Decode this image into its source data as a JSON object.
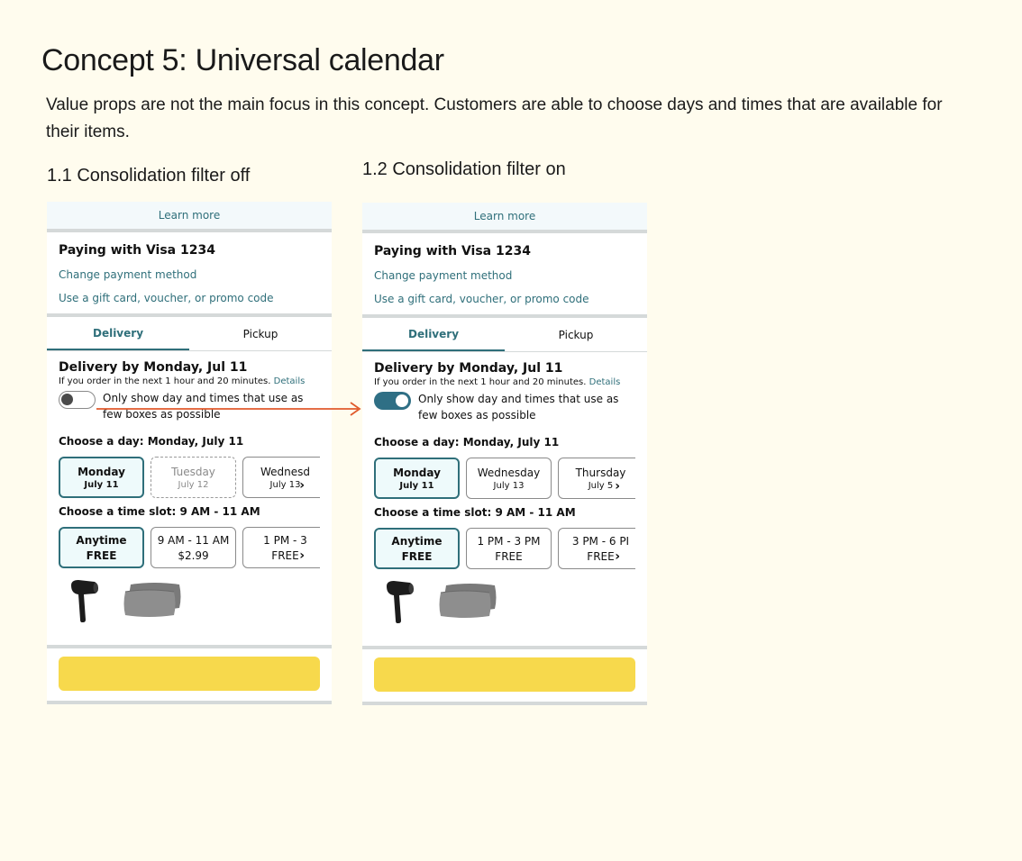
{
  "page": {
    "title": "Concept 5: Universal calendar",
    "description": "Value props are not the main focus in this concept. Customers are able to choose days and times that are available for their items.",
    "label_left": "1.1 Consolidation filter off",
    "label_right": "1.2 Consolidation filter on"
  },
  "colors": {
    "background": "#fffcee",
    "accent": "#2f6f7a",
    "cta": "#f7d94c",
    "arrow": "#e05a2b"
  },
  "left": {
    "learn_more": "Learn more",
    "payment": {
      "title": "Paying with Visa 1234",
      "change": "Change payment method",
      "gift": "Use a gift card, voucher, or promo code"
    },
    "tabs": [
      "Delivery",
      "Pickup"
    ],
    "delivery_title": "Delivery by Monday, Jul 11",
    "delivery_sub": "If you order in the next 1 hour and 20 minutes.",
    "details": "Details",
    "toggle_state": "off",
    "toggle_text": "Only show day and times that use as few boxes as possible",
    "choose_day": "Choose a day: Monday, July 11",
    "days": [
      {
        "day": "Monday",
        "date": "July 11"
      },
      {
        "day": "Tuesday",
        "date": "July 12"
      },
      {
        "day": "Wednesd",
        "date": "July 13"
      }
    ],
    "choose_slot": "Choose a time slot: 9 AM - 11 AM",
    "slots": [
      {
        "time": "Anytime",
        "price": "FREE"
      },
      {
        "time": "9 AM - 11 AM",
        "price": "$2.99"
      },
      {
        "time": "1 PM - 3",
        "price": "FREE"
      }
    ]
  },
  "right": {
    "learn_more": "Learn more",
    "payment": {
      "title": "Paying with Visa 1234",
      "change": "Change payment method",
      "gift": "Use a gift card, voucher, or promo code"
    },
    "tabs": [
      "Delivery",
      "Pickup"
    ],
    "delivery_title": "Delivery by Monday, Jul 11",
    "delivery_sub": "If you order in the next 1 hour and 20 minutes.",
    "details": "Details",
    "toggle_state": "on",
    "toggle_text": "Only show day and times that use as few boxes as possible",
    "choose_day": "Choose a day: Monday, July 11",
    "days": [
      {
        "day": "Monday",
        "date": "July 11"
      },
      {
        "day": "Wednesday",
        "date": "July 13"
      },
      {
        "day": "Thursday",
        "date": "July 5"
      }
    ],
    "choose_slot": "Choose a time slot: 9 AM - 11 AM",
    "slots": [
      {
        "time": "Anytime",
        "price": "FREE"
      },
      {
        "time": "1 PM - 3 PM",
        "price": "FREE"
      },
      {
        "time": "3 PM - 6 PI",
        "price": "FREE"
      }
    ]
  }
}
